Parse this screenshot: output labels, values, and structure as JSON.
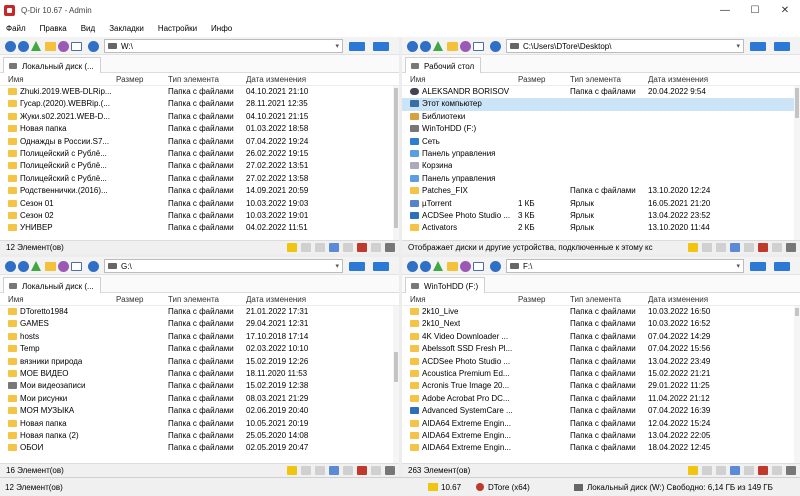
{
  "window": {
    "title": "Q-Dir 10.67 - Admin",
    "min": "—",
    "max": "☐",
    "close": "✕"
  },
  "menu": [
    "Файл",
    "Правка",
    "Вид",
    "Закладки",
    "Настройки",
    "Инфо"
  ],
  "columns": {
    "name": "Имя",
    "size": "Размер",
    "type": "Тип элемента",
    "date": "Дата изменения"
  },
  "panes": [
    {
      "path": "W:\\",
      "tab": "Локальный диск (...",
      "rows": [
        {
          "name": "Zhuki.2019.WEB-DLRip...",
          "size": "",
          "type": "Папка с файлами",
          "date": "04.10.2021 21:10"
        },
        {
          "name": "Гусар.(2020).WEBRip.(...",
          "size": "",
          "type": "Папка с файлами",
          "date": "28.11.2021 12:35"
        },
        {
          "name": "Жуки.s02.2021.WEB-D...",
          "size": "",
          "type": "Папка с файлами",
          "date": "04.10.2021 21:15"
        },
        {
          "name": "Новая папка",
          "size": "",
          "type": "Папка с файлами",
          "date": "01.03.2022 18:58"
        },
        {
          "name": "Однажды в России.S7...",
          "size": "",
          "type": "Папка с файлами",
          "date": "07.04.2022 19:24"
        },
        {
          "name": "Полицейский с Рублё...",
          "size": "",
          "type": "Папка с файлами",
          "date": "26.02.2022 19:15"
        },
        {
          "name": "Полицейский с Рублё...",
          "size": "",
          "type": "Папка с файлами",
          "date": "27.02.2022 13:51"
        },
        {
          "name": "Полицейский с Рублё...",
          "size": "",
          "type": "Папка с файлами",
          "date": "27.02.2022 13:58"
        },
        {
          "name": "Родственнички.(2016)...",
          "size": "",
          "type": "Папка с файлами",
          "date": "14.09.2021 20:59"
        },
        {
          "name": "Сезон 01",
          "size": "",
          "type": "Папка с файлами",
          "date": "10.03.2022 19:03"
        },
        {
          "name": "Сезон 02",
          "size": "",
          "type": "Папка с файлами",
          "date": "10.03.2022 19:01"
        },
        {
          "name": "УНИВЕР",
          "size": "",
          "type": "Папка с файлами",
          "date": "04.02.2022 11:51"
        }
      ],
      "status": "12 Элемент(ов)"
    },
    {
      "path": "C:\\Users\\DTore\\Desktop\\",
      "tab": "Рабочий стол",
      "rows": [
        {
          "name": "ALEKSANDR BORISOV",
          "size": "",
          "type": "Папка с файлами",
          "date": "20.04.2022 9:54",
          "icon": "user"
        },
        {
          "name": "Этот компьютер",
          "size": "",
          "type": "",
          "date": "",
          "icon": "pc",
          "selected": true
        },
        {
          "name": "Библиотеки",
          "size": "",
          "type": "",
          "date": "",
          "icon": "lib"
        },
        {
          "name": "WinToHDD (F:)",
          "size": "",
          "type": "",
          "date": "",
          "icon": "drvicon"
        },
        {
          "name": "Сеть",
          "size": "",
          "type": "",
          "date": "",
          "icon": "net"
        },
        {
          "name": "Панель управления",
          "size": "",
          "type": "",
          "date": "",
          "icon": "cp"
        },
        {
          "name": "Корзина",
          "size": "",
          "type": "",
          "date": "",
          "icon": "bin"
        },
        {
          "name": "Панель управления",
          "size": "",
          "type": "",
          "date": "",
          "icon": "cp"
        },
        {
          "name": "Patches_FIX",
          "size": "",
          "type": "Папка с файлами",
          "date": "13.10.2020 12:24",
          "icon": "folder"
        },
        {
          "name": "µTorrent",
          "size": "1 КБ",
          "type": "Ярлык",
          "date": "16.05.2021 21:20",
          "icon": "app"
        },
        {
          "name": "ACDSee Photo Studio ...",
          "size": "3 КБ",
          "type": "Ярлык",
          "date": "13.04.2022 23:52",
          "icon": "blue"
        },
        {
          "name": "Activators",
          "size": "2 КБ",
          "type": "Ярлык",
          "date": "13.10.2020 11:44",
          "icon": "folder"
        }
      ],
      "status": "Отображает диски и другие устройства, подключенные к этому кс"
    },
    {
      "path": "G:\\",
      "tab": "Локальный диск (...",
      "rows": [
        {
          "name": "DToretto1984",
          "size": "",
          "type": "Папка с файлами",
          "date": "21.01.2022 17:31"
        },
        {
          "name": "GAMES",
          "size": "",
          "type": "Папка с файлами",
          "date": "29.04.2021 12:31"
        },
        {
          "name": "hosts",
          "size": "",
          "type": "Папка с файлами",
          "date": "17.10.2018 17:14"
        },
        {
          "name": "Temp",
          "size": "",
          "type": "Папка с файлами",
          "date": "02.03.2022 10:10"
        },
        {
          "name": "вязники природа",
          "size": "",
          "type": "Папка с файлами",
          "date": "15.02.2019 12:26"
        },
        {
          "name": "МОЕ ВИДЕО",
          "size": "",
          "type": "Папка с файлами",
          "date": "18.11.2020 11:53"
        },
        {
          "name": "Мои видеозаписи",
          "size": "",
          "type": "Папка с файлами",
          "date": "15.02.2019 12:38",
          "icon": "drvicon"
        },
        {
          "name": "Мои рисунки",
          "size": "",
          "type": "Папка с файлами",
          "date": "08.03.2021 21:29"
        },
        {
          "name": "МОЯ МУЗЫКА",
          "size": "",
          "type": "Папка с файлами",
          "date": "02.06.2019 20:40"
        },
        {
          "name": "Новая папка",
          "size": "",
          "type": "Папка с файлами",
          "date": "10.05.2021 20:19"
        },
        {
          "name": "Новая папка (2)",
          "size": "",
          "type": "Папка с файлами",
          "date": "25.05.2020 14:08"
        },
        {
          "name": "ОБОИ",
          "size": "",
          "type": "Папка с файлами",
          "date": "02.05.2019 20:47"
        }
      ],
      "status": "16 Элемент(ов)"
    },
    {
      "path": "F:\\",
      "tab": "WinToHDD (F:)",
      "rows": [
        {
          "name": "2k10_Live",
          "size": "",
          "type": "Папка с файлами",
          "date": "10.03.2022 16:50"
        },
        {
          "name": "2k10_Next",
          "size": "",
          "type": "Папка с файлами",
          "date": "10.03.2022 16:52"
        },
        {
          "name": "4K Video Downloader ...",
          "size": "",
          "type": "Папка с файлами",
          "date": "07.04.2022 14:29"
        },
        {
          "name": "Abelssoft SSD Fresh Pl...",
          "size": "",
          "type": "Папка с файлами",
          "date": "07.04.2022 15:56"
        },
        {
          "name": "ACDSee Photo Studio ...",
          "size": "",
          "type": "Папка с файлами",
          "date": "13.04.2022 23:49"
        },
        {
          "name": "Acoustica Premium Ed...",
          "size": "",
          "type": "Папка с файлами",
          "date": "15.02.2022 21:21"
        },
        {
          "name": "Acronis True Image 20...",
          "size": "",
          "type": "Папка с файлами",
          "date": "29.01.2022 11:25"
        },
        {
          "name": "Adobe Acrobat Pro DC...",
          "size": "",
          "type": "Папка с файлами",
          "date": "11.04.2022 21:12"
        },
        {
          "name": "Advanced SystemCare ...",
          "size": "",
          "type": "Папка с файлами",
          "date": "07.04.2022 16:39",
          "icon": "blue"
        },
        {
          "name": "AIDA64 Extreme  Engin...",
          "size": "",
          "type": "Папка с файлами",
          "date": "12.04.2022 15:24"
        },
        {
          "name": "AIDA64 Extreme  Engin...",
          "size": "",
          "type": "Папка с файлами",
          "date": "13.04.2022 22:05"
        },
        {
          "name": "AIDA64 Extreme  Engin...",
          "size": "",
          "type": "Папка с файлами",
          "date": "18.04.2022 12:45"
        }
      ],
      "status": "263 Элемент(ов)"
    }
  ],
  "bottombar": {
    "left": "12 Элемент(ов)",
    "version": "10.67",
    "user": "DTore (x64)",
    "disk": "Локальный диск (W:) Свободно: 6,14 ГБ из 149 ГБ"
  }
}
